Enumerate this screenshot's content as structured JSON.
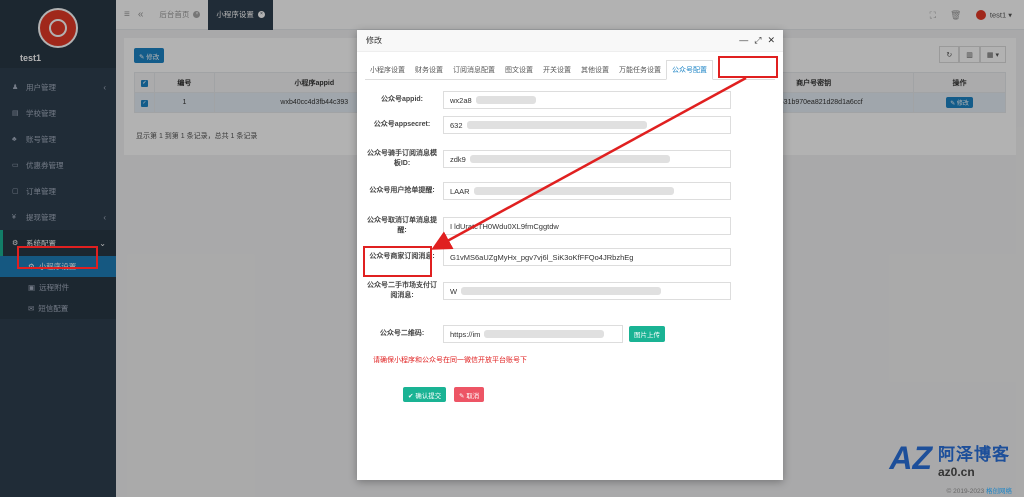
{
  "sidebar": {
    "username": "test1",
    "items": [
      {
        "label": "用户管理",
        "icon": "user-icon"
      },
      {
        "label": "学校管理",
        "icon": "school-icon"
      },
      {
        "label": "账号管理",
        "icon": "account-icon"
      },
      {
        "label": "优惠券管理",
        "icon": "coupon-icon"
      },
      {
        "label": "订单管理",
        "icon": "order-icon"
      },
      {
        "label": "提现管理",
        "icon": "withdraw-icon"
      },
      {
        "label": "系统配置",
        "icon": "gear-icon"
      }
    ],
    "subitems": [
      {
        "label": "小程序设置",
        "icon": "gear-icon"
      },
      {
        "label": "远程附件",
        "icon": "attachment-icon"
      },
      {
        "label": "短信配置",
        "icon": "sms-icon"
      }
    ]
  },
  "topbar": {
    "tabs": [
      {
        "label": "后台首页"
      },
      {
        "label": "小程序设置"
      }
    ],
    "user": "test1 ▾"
  },
  "toolbar": {
    "edit_label": "✎ 修改"
  },
  "table": {
    "headers": [
      "编号",
      "小程序appid",
      "商户号密钥",
      "操作"
    ],
    "rows": [
      {
        "id": "1",
        "appid": "wxb40cc4d3fb44c393",
        "secret": "dc1a531b970ea821d28d1a6ccf",
        "action": "✎ 修改"
      }
    ],
    "pager": "显示第 1 到第 1 条记录，总共 1 条记录"
  },
  "modal": {
    "title": "修改",
    "tabs": [
      "小程序设置",
      "财务设置",
      "订阅消息配置",
      "图文设置",
      "开关设置",
      "其他设置",
      "万能任务设置",
      "公众号配置"
    ],
    "fields": [
      {
        "label": "公众号appid:",
        "value": "wx2a8"
      },
      {
        "label": "公众号appsecret:",
        "value": "632"
      },
      {
        "label": "公众号骑手订阅消息模板ID:",
        "value": "zdk9"
      },
      {
        "label": "公众号用户抢单提醒:",
        "value": "LAAR"
      },
      {
        "label": "公众号取消订单消息提醒:",
        "value": "I            ldUratcTH0Wdu0XL9fmCggtdw"
      },
      {
        "label": "公众号商家订阅消息:",
        "value": "G1vMS6aUZgMyHx_pgv7vj6l_SiK3oKfFFQo4JRbzhEg"
      },
      {
        "label": "公众号二手市场支付订阅消息:",
        "value": "W"
      },
      {
        "label": "公众号二维码:",
        "value": "https://im"
      }
    ],
    "upload_label": "图片上传",
    "warning": "请确保小程序和公众号在同一微信开放平台账号下",
    "submit_label": "✔ 确认提交",
    "cancel_label": "✎ 取消"
  },
  "watermark": {
    "logo": "AZ",
    "name": "阿泽博客",
    "url": "az0.cn"
  },
  "copyright": {
    "text": "© 2019-2023 ",
    "brand": "格创网络"
  },
  "colors": {
    "sidebar": "#2f4050",
    "primary": "#1c84c6",
    "success": "#1ab394",
    "danger": "#ed5565",
    "highlight": "#e02020"
  }
}
